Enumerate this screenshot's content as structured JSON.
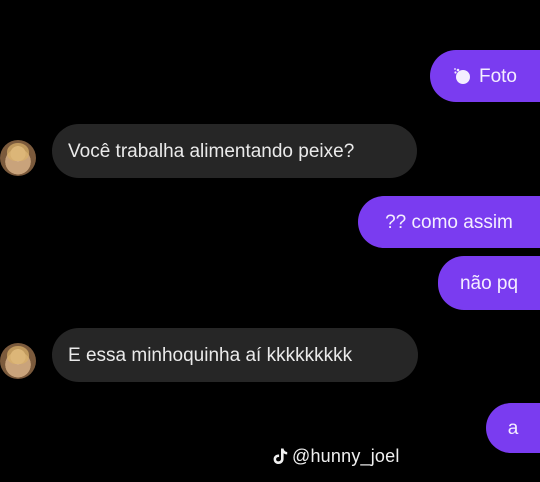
{
  "messages": [
    {
      "side": "sent",
      "text": "Foto",
      "icon": "photo-icon"
    },
    {
      "side": "received",
      "text": "Você trabalha alimentando peixe?"
    },
    {
      "side": "sent",
      "text": "?? como assim"
    },
    {
      "side": "sent",
      "text": "não pq"
    },
    {
      "side": "received",
      "text": "E essa minhoquinha aí kkkkkkkkk"
    },
    {
      "side": "sent",
      "text": "a"
    }
  ],
  "watermark": {
    "platform_icon": "tiktok-icon",
    "handle": "@hunny_joel"
  },
  "colors": {
    "background": "#000000",
    "sent_bubble": "#7a3cf0",
    "received_bubble": "#262626"
  }
}
